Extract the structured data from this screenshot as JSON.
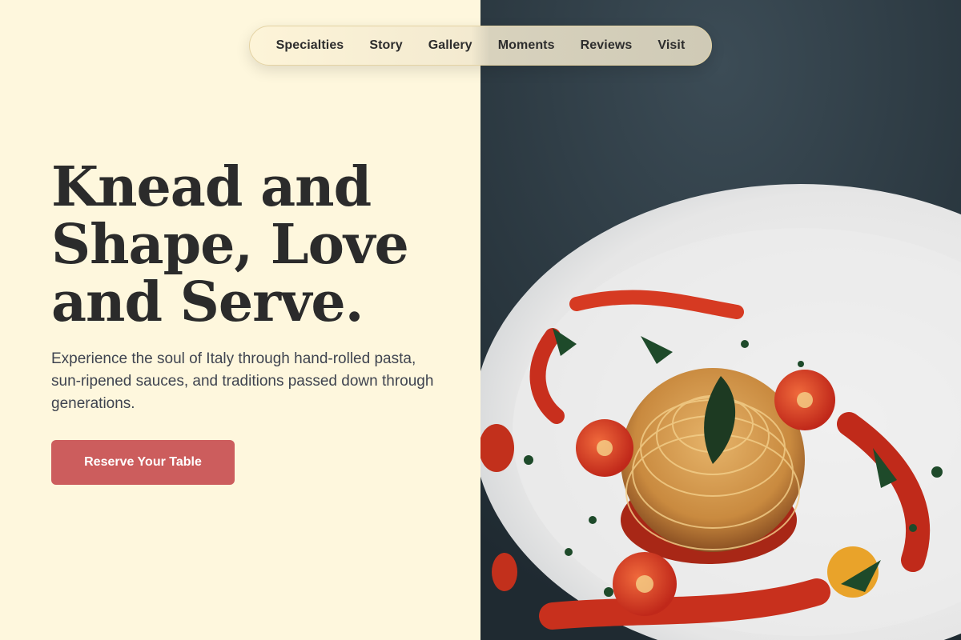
{
  "nav": {
    "items": [
      {
        "label": "Specialties"
      },
      {
        "label": "Story"
      },
      {
        "label": "Gallery"
      },
      {
        "label": "Moments"
      },
      {
        "label": "Reviews"
      },
      {
        "label": "Visit"
      }
    ]
  },
  "hero": {
    "headline_line1": "Knead and",
    "headline_line2": "Shape, Love",
    "headline_line3": "and Serve.",
    "subtitle": "Experience the soul of Italy through hand-rolled pasta, sun-ripened sauces, and traditions passed down through generations.",
    "cta_label": "Reserve Your Table"
  },
  "colors": {
    "background": "#fef7dd",
    "cta": "#cc5d5d",
    "text": "#2b2b2b"
  }
}
